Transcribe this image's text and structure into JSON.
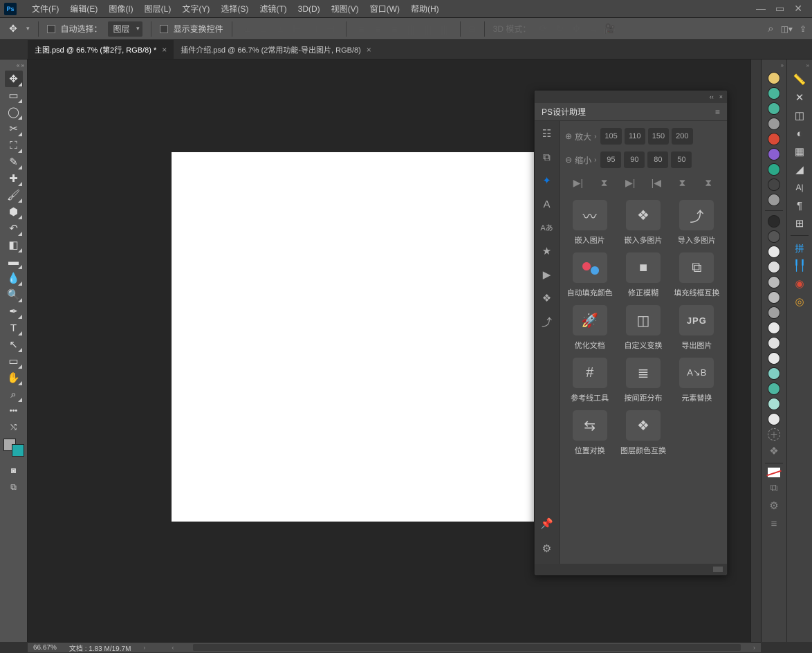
{
  "menubar": {
    "items": [
      "文件(F)",
      "编辑(E)",
      "图像(I)",
      "图层(L)",
      "文字(Y)",
      "选择(S)",
      "滤镜(T)",
      "3D(D)",
      "视图(V)",
      "窗口(W)",
      "帮助(H)"
    ]
  },
  "optionsbar": {
    "auto_select": "自动选择：",
    "layer_select": "图层",
    "show_transform": "显示变换控件",
    "mode_label": "3D 模式："
  },
  "doctabs": {
    "active": "主图.psd @ 66.7% (第2行, RGB/8) *",
    "inactive": "插件介绍.psd @ 66.7% (2常用功能-导出图片, RGB/8)"
  },
  "plugin": {
    "title": "PS设计助理",
    "zoom_in_label": "放大",
    "zoom_out_label": "缩小",
    "zoom_in_vals": [
      "105",
      "110",
      "150",
      "200"
    ],
    "zoom_out_vals": [
      "95",
      "90",
      "80",
      "50"
    ],
    "tools": {
      "r1": [
        "嵌入图片",
        "嵌入多图片",
        "导入多图片"
      ],
      "r2": [
        "自动填充颜色",
        "修正模糊",
        "填充线框互换"
      ],
      "r3": [
        "优化文档",
        "自定义变换",
        "导出图片"
      ],
      "r4": [
        "参考线工具",
        "按间距分布",
        "元素替换"
      ],
      "r5": [
        "位置对换",
        "图层颜色互换"
      ]
    }
  },
  "swatches_left": [
    "#e8c870",
    "#49b59a",
    "#49b59a",
    "#9a9a9a",
    "#d94a36",
    "#8a5fd0",
    "#2ba888",
    "#444444",
    "#9a9a9a"
  ],
  "swatches_right2_top": [
    "#2a2a2a",
    "#555555",
    "#e8e8e8",
    "#dddddd",
    "#bababa",
    "#bababa",
    "#a0a0a0",
    "#e8e8e8",
    "#e0e0e0",
    "#e8e8e8",
    "#80cfc4",
    "#4db6a0",
    "#a8e0d4",
    "#e8e8e8"
  ],
  "status": {
    "zoom": "66.67%",
    "docinfo": "文档 : 1.83 M/19.7M"
  }
}
